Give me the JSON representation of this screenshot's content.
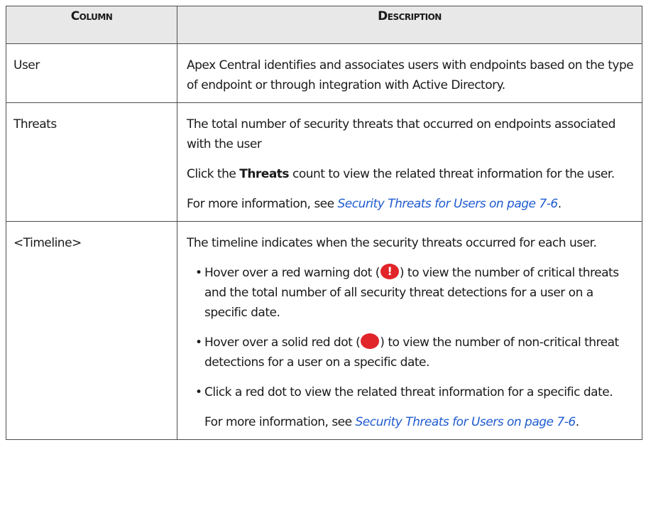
{
  "table": {
    "headers": {
      "column": "Column",
      "description": "Description"
    },
    "rows": {
      "user": {
        "column": "User",
        "description": "Apex Central identifies and associates users with endpoints based on the type of endpoint or through integration with Active Directory."
      },
      "threats": {
        "column": "Threats",
        "p1": "The total number of security threats that occurred on endpoints associated with the user",
        "p2_before": "Click the ",
        "p2_bold": "Threats",
        "p2_after": " count to view the related threat information for the user.",
        "p3_before": "For more information, see ",
        "p3_link": "Security Threats for Users on page 7-6",
        "p3_after": "."
      },
      "timeline": {
        "column": "<Timeline>",
        "intro": "The timeline indicates when the security threats occurred for each user.",
        "bullet1_before": "Hover over a red warning dot (",
        "bullet1_after": ") to view the number of critical threats and the total number of all security threat detections for a user on a specific date.",
        "bullet2_before": "Hover over a solid red dot (",
        "bullet2_after": ") to view the number of non-critical threat detections for a user on a specific date.",
        "bullet3": "Click a red dot to view the related threat information for a specific date.",
        "note_before": "For more information, see ",
        "note_link": "Security Threats for Users on page 7-6",
        "note_after": "."
      }
    }
  },
  "icons": {
    "warning_dot": "red-warning-dot-icon",
    "solid_dot": "solid-red-dot-icon"
  },
  "colors": {
    "link": "#1f5bd0",
    "dot_red": "#e0242a",
    "header_bg": "#e8e8e8"
  }
}
